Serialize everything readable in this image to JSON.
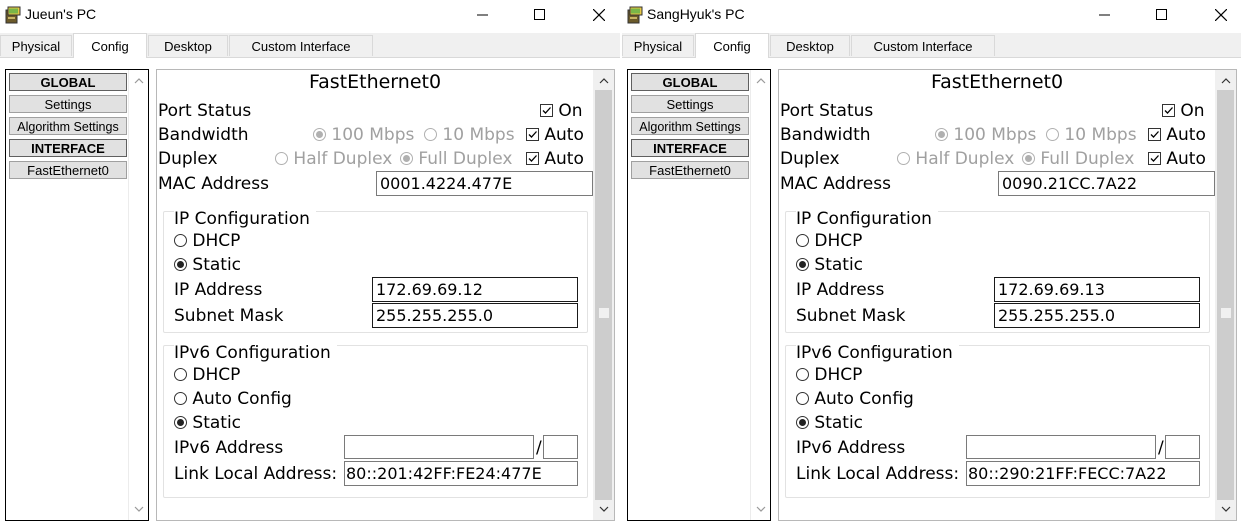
{
  "tabs": [
    "Physical",
    "Config",
    "Desktop",
    "Custom Interface"
  ],
  "sidebar": {
    "global_header": "GLOBAL",
    "settings": "Settings",
    "algorithm_settings": "Algorithm Settings",
    "interface_header": "INTERFACE",
    "interface_item": "FastEthernet0"
  },
  "labels": {
    "section_title": "FastEthernet0",
    "port_status": "Port Status",
    "on": "On",
    "bandwidth": "Bandwidth",
    "bw_100": "100 Mbps",
    "bw_10": "10 Mbps",
    "auto": "Auto",
    "duplex": "Duplex",
    "half_duplex": "Half Duplex",
    "full_duplex": "Full Duplex",
    "mac_address": "MAC Address",
    "ip_configuration": "IP Configuration",
    "dhcp": "DHCP",
    "static": "Static",
    "ip_address": "IP Address",
    "subnet_mask": "Subnet Mask",
    "ipv6_configuration": "IPv6 Configuration",
    "auto_config": "Auto Config",
    "ipv6_address": "IPv6 Address",
    "prefix_separator": "/",
    "link_local_address": "Link Local Address:"
  },
  "windows": [
    {
      "title": "Jueun's PC",
      "mac": "0001.4224.477E",
      "ip": "172.69.69.12",
      "mask": "255.255.255.0",
      "ipv6": "",
      "prefix": "",
      "link_local": "80::201:42FF:FE24:477E"
    },
    {
      "title": "SangHyuk's PC",
      "mac": "0090.21CC.7A22",
      "ip": "172.69.69.13",
      "mask": "255.255.255.0",
      "ipv6": "",
      "prefix": "",
      "link_local": "80::290:21FF:FECC:7A22"
    }
  ],
  "state": {
    "active_tab": "Config",
    "port_on": true,
    "bandwidth_auto": true,
    "bandwidth_selected": "100 Mbps",
    "duplex_auto": true,
    "duplex_selected": "Full Duplex",
    "ip_mode": "Static",
    "ipv6_mode": "Static"
  },
  "icons": {
    "app": "pc-tower-icon",
    "minimize": "minimize-icon",
    "maximize": "maximize-icon",
    "close": "close-icon",
    "scroll_up": "chevron-up-icon",
    "scroll_down": "chevron-down-icon",
    "checkbox": "checkmark-icon"
  },
  "colors": {
    "tab_bar": "#f0f0f0",
    "sidebar_button": "#e1e1e1",
    "scrollbar_track": "#cdcdcd",
    "disabled_text": "#a0a0a0"
  }
}
